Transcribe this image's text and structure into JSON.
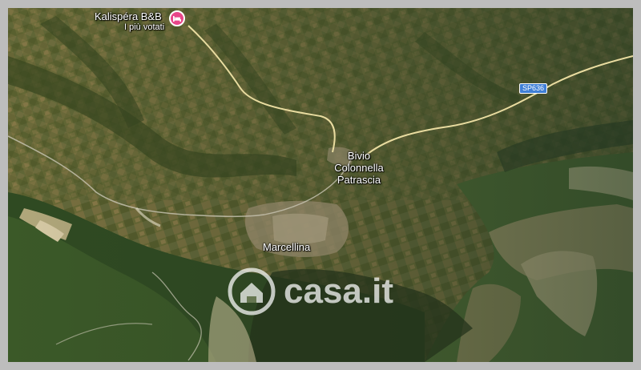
{
  "map": {
    "places": {
      "bivio": [
        "Bivio",
        "Colonnella",
        "Patrascia"
      ],
      "marcellina": "Marcellina"
    },
    "poi": {
      "name": "Kalispéra B&B",
      "subtitle": "I più votati",
      "icon": "bed-icon",
      "color": "#e8468a"
    },
    "road_shield": "SP636",
    "watermark": "casa.it"
  },
  "colors": {
    "frame": "#bdbdbd",
    "road": "#e9dca0",
    "shield": "#3f7fd6"
  }
}
